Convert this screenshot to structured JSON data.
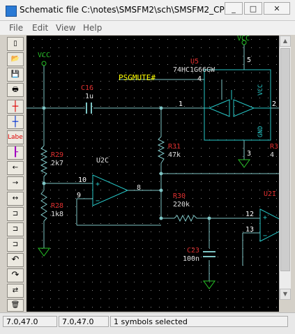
{
  "window": {
    "title": "Schematic file C:\\notes\\SMSFM2\\sch\\SMSFM2_CPL...",
    "minimize": "_",
    "maximize": "□",
    "close": "✕"
  },
  "menu": {
    "file": "File",
    "edit": "Edit",
    "view": "View",
    "help": "Help"
  },
  "toolbar": {
    "new": "▯",
    "open": "📂",
    "save": "💾",
    "print": "🖶",
    "wire_red": "┼",
    "wire_blue": "┼",
    "label": "Label",
    "bus": "┠",
    "port_left": "←",
    "port_right": "→",
    "port_both": "↔",
    "gate1": "⊐",
    "gate2": "⊐",
    "gate3": "⊐",
    "undo": "↶",
    "redo": "↷",
    "mirror": "⇄",
    "delete": "🗑",
    "rotate": "⇆"
  },
  "schematic": {
    "vcc_left": "VCC",
    "vcc_right": "VCC",
    "u5_ref": "U5",
    "u5_part": "74HC1G66GW",
    "u5_pin_vcc": "VCC",
    "u5_pin_gnd": "GND",
    "net_label": "PSGMUTE#",
    "pin4": "4",
    "pin5": "5",
    "pin1": "1",
    "pin2": "2",
    "pin3": "3",
    "c16_ref": "C16",
    "c16_val": "1u",
    "r29_ref": "R29",
    "r29_val": "2k7",
    "r31_ref": "R31",
    "r31_val": "47k",
    "r_right_ref": "R3",
    "r_right_val": "4",
    "u2c_ref": "U2C",
    "u2c_out": "8",
    "pin10": "10",
    "pin9": "9",
    "r28_ref": "R28",
    "r28_val": "1k8",
    "r30_ref": "R30",
    "r30_val": "220k",
    "c23_ref": "C23",
    "c23_val": "100n",
    "u2d_ref": "U2I",
    "pin12": "12",
    "pin13": "13",
    "opamp_plus": "+",
    "opamp_minus": "−"
  },
  "status": {
    "coord1": "7.0,47.0",
    "coord2": "7.0,47.0",
    "message": "1 symbols selected"
  },
  "colors": {
    "background": "#000000",
    "grid": "#8a8a8a",
    "wire": "#7ec5c5",
    "component": "#27c8c8",
    "ref_text": "#e03030",
    "value_text": "#e0e0e0",
    "net_label": "#ffff00",
    "power": "#27c227",
    "pin_num": "#ffffff"
  }
}
